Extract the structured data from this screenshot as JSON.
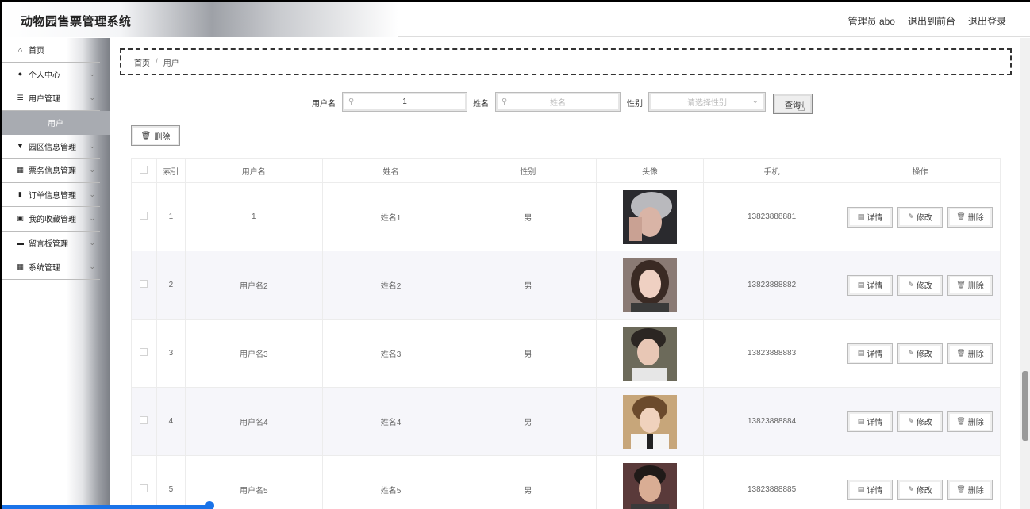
{
  "header": {
    "title": "动物园售票管理系统",
    "admin": "管理员 abo",
    "to_front": "退出到前台",
    "logout": "退出登录"
  },
  "sidebar": {
    "items": [
      {
        "label": "首页",
        "icon": "home-icon",
        "glyph": "⌂",
        "chevron": false
      },
      {
        "label": "个人中心",
        "icon": "user-icon",
        "glyph": "●",
        "chevron": true
      },
      {
        "label": "用户管理",
        "icon": "list-icon",
        "glyph": "☰",
        "chevron": true
      },
      {
        "label": "园区信息管理",
        "icon": "flag-icon",
        "glyph": "▼",
        "chevron": true
      },
      {
        "label": "票务信息管理",
        "icon": "grid-icon",
        "glyph": "▦",
        "chevron": true
      },
      {
        "label": "订单信息管理",
        "icon": "bar-chart-icon",
        "glyph": "▮",
        "chevron": true
      },
      {
        "label": "我的收藏管理",
        "icon": "clipboard-icon",
        "glyph": "▣",
        "chevron": true
      },
      {
        "label": "留言板管理",
        "icon": "monitor-icon",
        "glyph": "▬",
        "chevron": true
      },
      {
        "label": "系统管理",
        "icon": "grid-icon",
        "glyph": "▦",
        "chevron": true
      }
    ],
    "sub_item": "用户"
  },
  "breadcrumb": {
    "home": "首页",
    "sep": "/",
    "current": "用户"
  },
  "search": {
    "username_label": "用户名",
    "username_value": "1",
    "name_label": "姓名",
    "name_placeholder": "姓名",
    "gender_label": "性别",
    "gender_placeholder": "请选择性别",
    "query_button": "查询"
  },
  "toolbar": {
    "delete_label": "删除"
  },
  "table": {
    "headers": [
      "索引",
      "用户名",
      "姓名",
      "性别",
      "头像",
      "手机",
      "操作"
    ],
    "rows": [
      {
        "index": "1",
        "username": "1",
        "name": "姓名1",
        "gender": "男",
        "phone": "13823888881"
      },
      {
        "index": "2",
        "username": "用户名2",
        "name": "姓名2",
        "gender": "男",
        "phone": "13823888882"
      },
      {
        "index": "3",
        "username": "用户名3",
        "name": "姓名3",
        "gender": "男",
        "phone": "13823888883"
      },
      {
        "index": "4",
        "username": "用户名4",
        "name": "姓名4",
        "gender": "男",
        "phone": "13823888884"
      },
      {
        "index": "5",
        "username": "用户名5",
        "name": "姓名5",
        "gender": "男",
        "phone": "13823888885"
      }
    ],
    "ops": {
      "detail": "详情",
      "edit": "修改",
      "delete": "删除"
    }
  },
  "colors": {
    "accent": "#1a73e8",
    "sidebar_active": "#a8abb1"
  }
}
